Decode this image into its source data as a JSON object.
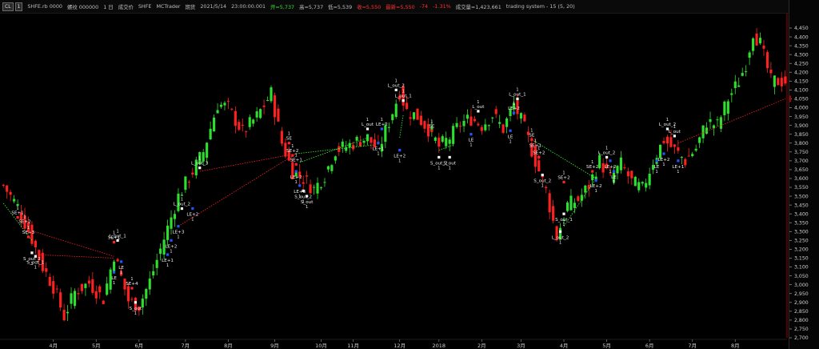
{
  "toolbar": {
    "btn_symbol": "CL",
    "btn_interval": "1",
    "symbol": "SHFE.rb 0000",
    "name": "螺纹 000000",
    "period": "1 日",
    "view": "成交价",
    "exchange": "SHFE",
    "source": "MCTrader",
    "kind": "期货",
    "datetime": "2021/5/14",
    "time": "23:00:00.001",
    "open": "开=5,737",
    "high": "高=5,737",
    "low": "低=5,539",
    "close": "收=5,550",
    "last": "最新=5,550",
    "change": "-74",
    "change_pct": "-1.31%",
    "volume": "成交量=1,423,661",
    "strategy": "trading system - 15 (5, 20)"
  },
  "colors": {
    "background": "#000000",
    "up_candle": "#2ee02e",
    "down_candle": "#ff2020",
    "long_entry": "#2255ff",
    "short_entry": "#ff2222",
    "exit_marker": "#ffffff",
    "trade_line_profit": "#33ff33",
    "trade_line_loss": "#ff2222",
    "axis_text": "#cfcfcf",
    "current_price_line": "#aa0000"
  },
  "chart_data": {
    "type": "candlestick",
    "y_axis": {
      "min": 2700,
      "max": 4450,
      "step": 50,
      "tick_labels": [
        "4,450",
        "4,400",
        "4,350",
        "4,300",
        "4,250",
        "4,200",
        "4,150",
        "4,100",
        "4,050",
        "4,000",
        "3,950",
        "3,900",
        "3,850",
        "3,800",
        "3,750",
        "3,700",
        "3,650",
        "3,600",
        "3,550",
        "3,500",
        "3,450",
        "3,400",
        "3,350",
        "3,300",
        "3,250",
        "3,200",
        "3,150",
        "3,100",
        "3,050",
        "3,000",
        "2,950",
        "2,900",
        "2,850",
        "2,800",
        "2,750",
        "2,700"
      ]
    },
    "x_axis": {
      "labels": [
        "4月",
        "5月",
        "6月",
        "7月",
        "8月",
        "9月",
        "10月",
        "11月",
        "12月",
        "2018",
        "2月",
        "3月",
        "4月",
        "5月",
        "6月",
        "7月",
        "8月"
      ],
      "label_index": [
        14,
        26,
        38,
        51,
        63,
        76,
        89,
        98,
        111,
        122,
        134,
        145,
        157,
        169,
        181,
        193,
        205
      ]
    },
    "anchors": [
      [
        0,
        3560
      ],
      [
        4,
        3440
      ],
      [
        8,
        3260
      ],
      [
        11,
        3100
      ],
      [
        14,
        2990
      ],
      [
        17,
        2820
      ],
      [
        20,
        2960
      ],
      [
        24,
        3010
      ],
      [
        28,
        2920
      ],
      [
        31,
        3170
      ],
      [
        35,
        2910
      ],
      [
        38,
        2880
      ],
      [
        41,
        3020
      ],
      [
        45,
        3260
      ],
      [
        49,
        3500
      ],
      [
        53,
        3640
      ],
      [
        56,
        3750
      ],
      [
        60,
        4020
      ],
      [
        63,
        4000
      ],
      [
        67,
        3860
      ],
      [
        71,
        3950
      ],
      [
        75,
        4080
      ],
      [
        78,
        3800
      ],
      [
        81,
        3640
      ],
      [
        84,
        3600
      ],
      [
        87,
        3540
      ],
      [
        90,
        3620
      ],
      [
        93,
        3760
      ],
      [
        96,
        3780
      ],
      [
        99,
        3810
      ],
      [
        102,
        3830
      ],
      [
        105,
        3760
      ],
      [
        108,
        3920
      ],
      [
        111,
        4090
      ],
      [
        113,
        3980
      ],
      [
        116,
        3950
      ],
      [
        119,
        3880
      ],
      [
        122,
        3780
      ],
      [
        125,
        3830
      ],
      [
        128,
        3910
      ],
      [
        131,
        3940
      ],
      [
        134,
        3900
      ],
      [
        137,
        3960
      ],
      [
        140,
        3880
      ],
      [
        143,
        4020
      ],
      [
        146,
        3880
      ],
      [
        149,
        3700
      ],
      [
        152,
        3530
      ],
      [
        155,
        3270
      ],
      [
        158,
        3450
      ],
      [
        161,
        3480
      ],
      [
        164,
        3560
      ],
      [
        167,
        3700
      ],
      [
        170,
        3600
      ],
      [
        173,
        3680
      ],
      [
        176,
        3580
      ],
      [
        179,
        3540
      ],
      [
        182,
        3700
      ],
      [
        185,
        3820
      ],
      [
        188,
        3760
      ],
      [
        191,
        3700
      ],
      [
        194,
        3770
      ],
      [
        197,
        3920
      ],
      [
        200,
        3900
      ],
      [
        203,
        4050
      ],
      [
        206,
        4150
      ],
      [
        208,
        4250
      ],
      [
        210,
        4430
      ],
      [
        212,
        4360
      ],
      [
        215,
        4150
      ]
    ],
    "signals": [
      {
        "i": 4,
        "label": "SE+1",
        "kind": "short",
        "price": 3380,
        "pos": "above"
      },
      {
        "i": 6,
        "label": "SE+2",
        "kind": "short",
        "price": 3330,
        "pos": "above"
      },
      {
        "i": 7,
        "label": "SE+3",
        "kind": "short",
        "price": 3270,
        "pos": "above"
      },
      {
        "i": 8,
        "label": "S_out_2",
        "kind": "exit",
        "price": 3180,
        "pos": "below"
      },
      {
        "i": 9,
        "label": "S_out_1",
        "kind": "exit",
        "price": 3160,
        "pos": "below"
      },
      {
        "i": 31,
        "label": "SE+1",
        "kind": "short",
        "price": 3240,
        "pos": "above"
      },
      {
        "i": 32,
        "label": "L_out_1",
        "kind": "exit",
        "price": 3250,
        "pos": "above"
      },
      {
        "i": 33,
        "label": "LE",
        "kind": "long",
        "price": 3130,
        "pos": "below"
      },
      {
        "i": 31,
        "label": "LE",
        "kind": "long",
        "price": 3070,
        "pos": "below"
      },
      {
        "i": 36,
        "label": "SE+4",
        "kind": "short",
        "price": 2980,
        "pos": "above"
      },
      {
        "i": 37,
        "label": "S_out",
        "kind": "exit",
        "price": 2900,
        "pos": "below"
      },
      {
        "i": 46,
        "label": "LE+1",
        "kind": "long",
        "price": 3170,
        "pos": "below"
      },
      {
        "i": 47,
        "label": "LE+2",
        "kind": "long",
        "price": 3250,
        "pos": "below"
      },
      {
        "i": 49,
        "label": "LE+3",
        "kind": "long",
        "price": 3330,
        "pos": "below"
      },
      {
        "i": 50,
        "label": "L_out_2",
        "kind": "exit",
        "price": 3430,
        "pos": "above"
      },
      {
        "i": 53,
        "label": "LE+2",
        "kind": "long",
        "price": 3430,
        "pos": "below"
      },
      {
        "i": 55,
        "label": "L_out_3",
        "kind": "exit",
        "price": 3660,
        "pos": "above"
      },
      {
        "i": 80,
        "label": "SE",
        "kind": "short",
        "price": 3800,
        "pos": "above"
      },
      {
        "i": 81,
        "label": "SE+2",
        "kind": "short",
        "price": 3730,
        "pos": "above"
      },
      {
        "i": 82,
        "label": "SE+1",
        "kind": "short",
        "price": 3680,
        "pos": "above"
      },
      {
        "i": 82,
        "label": "LE+2",
        "kind": "long",
        "price": 3640,
        "pos": "below"
      },
      {
        "i": 83,
        "label": "LE+3",
        "kind": "long",
        "price": 3560,
        "pos": "below"
      },
      {
        "i": 84,
        "label": "S_out_2",
        "kind": "exit",
        "price": 3530,
        "pos": "below"
      },
      {
        "i": 85,
        "label": "S_out",
        "kind": "exit",
        "price": 3500,
        "pos": "below"
      },
      {
        "i": 102,
        "label": "L_out",
        "kind": "exit",
        "price": 3880,
        "pos": "above"
      },
      {
        "i": 106,
        "label": "LE+2",
        "kind": "long",
        "price": 3880,
        "pos": "above"
      },
      {
        "i": 105,
        "label": "LE+1",
        "kind": "long",
        "price": 3800,
        "pos": "below"
      },
      {
        "i": 110,
        "label": "L_out_2",
        "kind": "exit",
        "price": 4100,
        "pos": "above"
      },
      {
        "i": 112,
        "label": "L_out_1",
        "kind": "exit",
        "price": 4040,
        "pos": "above"
      },
      {
        "i": 111,
        "label": "LE+2",
        "kind": "long",
        "price": 3760,
        "pos": "below"
      },
      {
        "i": 120,
        "label": "SE",
        "kind": "short",
        "price": 3870,
        "pos": "above"
      },
      {
        "i": 122,
        "label": "S_out_2",
        "kind": "exit",
        "price": 3720,
        "pos": "below"
      },
      {
        "i": 125,
        "label": "S_out",
        "kind": "exit",
        "price": 3720,
        "pos": "below"
      },
      {
        "i": 131,
        "label": "LE",
        "kind": "long",
        "price": 3850,
        "pos": "below"
      },
      {
        "i": 133,
        "label": "L_out",
        "kind": "exit",
        "price": 3980,
        "pos": "above"
      },
      {
        "i": 144,
        "label": "L_out_1",
        "kind": "exit",
        "price": 4050,
        "pos": "above"
      },
      {
        "i": 143,
        "label": "LE+2",
        "kind": "long",
        "price": 3970,
        "pos": "above"
      },
      {
        "i": 142,
        "label": "LE",
        "kind": "long",
        "price": 3870,
        "pos": "below"
      },
      {
        "i": 148,
        "label": "SE",
        "kind": "short",
        "price": 3820,
        "pos": "above"
      },
      {
        "i": 149,
        "label": "SE+1",
        "kind": "short",
        "price": 3760,
        "pos": "above"
      },
      {
        "i": 150,
        "label": "SE+2",
        "kind": "short",
        "price": 3720,
        "pos": "above"
      },
      {
        "i": 151,
        "label": "S_out_2",
        "kind": "exit",
        "price": 3620,
        "pos": "below"
      },
      {
        "i": 157,
        "label": "SE+2",
        "kind": "short",
        "price": 3580,
        "pos": "above"
      },
      {
        "i": 157,
        "label": "S_out_1",
        "kind": "exit",
        "price": 3400,
        "pos": "below"
      },
      {
        "i": 156,
        "label": "L_out_2",
        "kind": "exit",
        "price": 3300,
        "pos": "below"
      },
      {
        "i": 165,
        "label": "SE+2",
        "kind": "short",
        "price": 3640,
        "pos": "above"
      },
      {
        "i": 166,
        "label": "LE+2",
        "kind": "long",
        "price": 3590,
        "pos": "below"
      },
      {
        "i": 169,
        "label": "L_out_2",
        "kind": "exit",
        "price": 3720,
        "pos": "above"
      },
      {
        "i": 171,
        "label": "LE",
        "kind": "long",
        "price": 3640,
        "pos": "below"
      },
      {
        "i": 170,
        "label": "LE+2",
        "kind": "long",
        "price": 3700,
        "pos": "below"
      },
      {
        "i": 183,
        "label": "LE",
        "kind": "long",
        "price": 3700,
        "pos": "below"
      },
      {
        "i": 185,
        "label": "LE+2",
        "kind": "long",
        "price": 3740,
        "pos": "below"
      },
      {
        "i": 186,
        "label": "L_out_2",
        "kind": "exit",
        "price": 3880,
        "pos": "above"
      },
      {
        "i": 188,
        "label": "L_out",
        "kind": "exit",
        "price": 3840,
        "pos": "above"
      },
      {
        "i": 189,
        "label": "LE+1",
        "kind": "long",
        "price": 3700,
        "pos": "below"
      }
    ],
    "trade_lines": [
      {
        "from": [
          7,
          3310
        ],
        "to": [
          31,
          3160
        ],
        "result": "loss"
      },
      {
        "from": [
          9,
          3170
        ],
        "to": [
          31,
          3150
        ],
        "result": "loss"
      },
      {
        "from": [
          0,
          3460
        ],
        "to": [
          8,
          3250
        ],
        "result": "profit"
      },
      {
        "from": [
          49,
          3330
        ],
        "to": [
          82,
          3740
        ],
        "result": "loss"
      },
      {
        "from": [
          55,
          3640
        ],
        "to": [
          82,
          3740
        ],
        "result": "loss"
      },
      {
        "from": [
          82,
          3740
        ],
        "to": [
          104,
          3790
        ],
        "result": "profit"
      },
      {
        "from": [
          83,
          3690
        ],
        "to": [
          102,
          3830
        ],
        "result": "profit"
      },
      {
        "from": [
          111,
          3830
        ],
        "to": [
          112,
          3960
        ],
        "result": "profit"
      },
      {
        "from": [
          122,
          3760
        ],
        "to": [
          126,
          3790
        ],
        "result": "profit"
      },
      {
        "from": [
          148,
          3820
        ],
        "to": [
          166,
          3600
        ],
        "result": "profit"
      },
      {
        "from": [
          157,
          3330
        ],
        "to": [
          166,
          3600
        ],
        "result": "profit"
      },
      {
        "from": [
          189,
          3800
        ],
        "to": [
          219,
          4050
        ],
        "result": "loss"
      }
    ],
    "last_price": 4050
  }
}
